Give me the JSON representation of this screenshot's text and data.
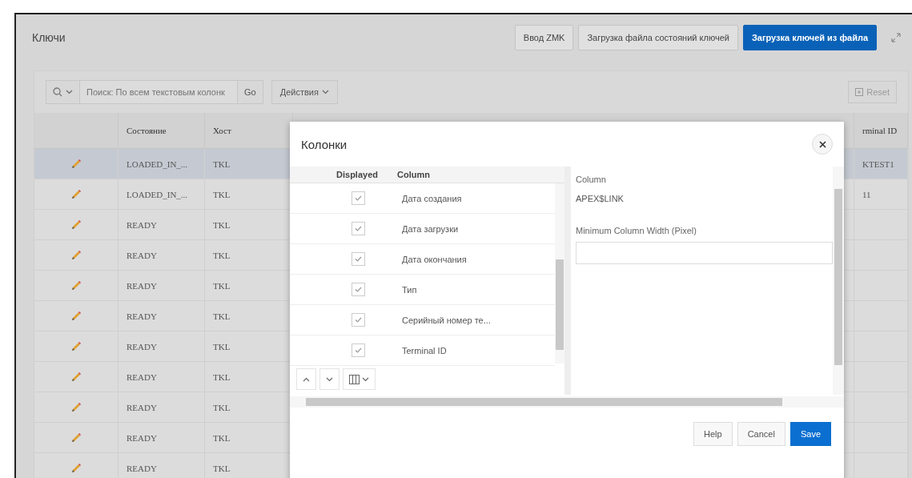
{
  "region": {
    "title": "Ключи",
    "buttons": [
      {
        "label": "Ввод ZMK",
        "kind": "default"
      },
      {
        "label": "Загрузка файла состояний ключей",
        "kind": "default"
      },
      {
        "label": "Загрузка ключей из файла",
        "kind": "primary"
      }
    ]
  },
  "toolbar": {
    "search_placeholder": "Поиск: По всем текстовым колонк",
    "go": "Go",
    "actions": "Действия",
    "reset": "Reset"
  },
  "table": {
    "columns": [
      "Состояние",
      "Хост"
    ],
    "last_column": "rminal ID",
    "rows": [
      {
        "state": "LOADED_IN_...",
        "host": "TKL",
        "last": "KTEST1",
        "selected": true
      },
      {
        "state": "LOADED_IN_...",
        "host": "TKL",
        "last": "11",
        "selected": false
      },
      {
        "state": "READY",
        "host": "TKL",
        "selected": false
      },
      {
        "state": "READY",
        "host": "TKL",
        "selected": false
      },
      {
        "state": "READY",
        "host": "TKL",
        "selected": false
      },
      {
        "state": "READY",
        "host": "TKL",
        "selected": false
      },
      {
        "state": "READY",
        "host": "TKL",
        "selected": false
      },
      {
        "state": "READY",
        "host": "TKL",
        "selected": false
      },
      {
        "state": "READY",
        "host": "TKL",
        "selected": false
      },
      {
        "state": "READY",
        "host": "TKL",
        "selected": false
      },
      {
        "state": "READY",
        "host": "TKL",
        "selected": false
      }
    ]
  },
  "dialog": {
    "title": "Колонки",
    "list_columns": [
      "Displayed",
      "Column"
    ],
    "items": [
      {
        "label": "Дата создания",
        "checked": true
      },
      {
        "label": "Дата загрузки",
        "checked": true
      },
      {
        "label": "Дата окончания",
        "checked": true
      },
      {
        "label": "Тип",
        "checked": true
      },
      {
        "label": "Серийный номер те...",
        "checked": true
      },
      {
        "label": "Terminal ID",
        "checked": true
      }
    ],
    "detail": {
      "label": "Column",
      "value": "APEX$LINK",
      "width_label": "Minimum Column Width (Pixel)"
    },
    "buttons": [
      {
        "label": "Help",
        "kind": "default"
      },
      {
        "label": "Cancel",
        "kind": "default"
      },
      {
        "label": "Save",
        "kind": "primary"
      }
    ]
  }
}
